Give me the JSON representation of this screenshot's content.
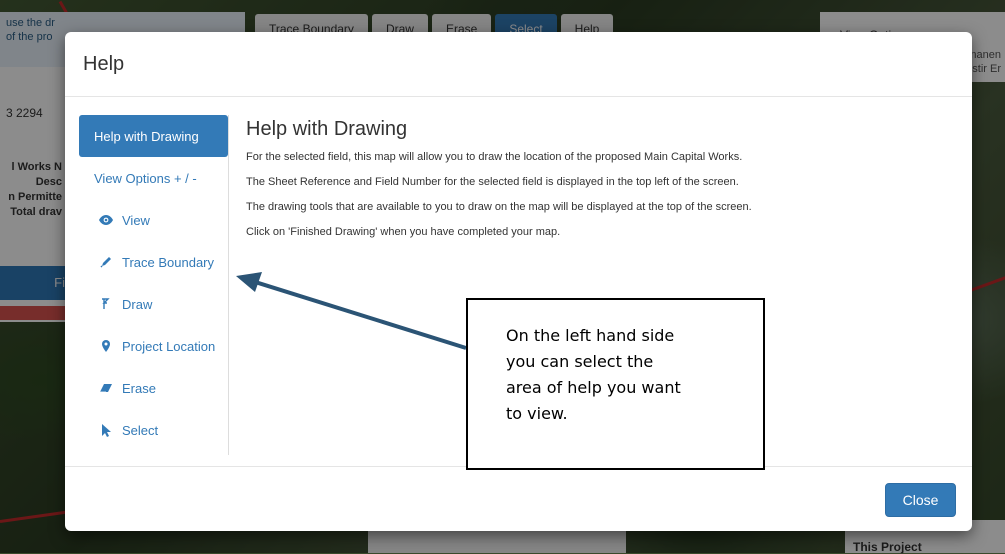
{
  "background": {
    "left_hint_line1": "use the dr",
    "left_hint_line2": "of the pro",
    "left_number": "3 2294",
    "left_lines": [
      "l Works N",
      "Desc",
      "n Permitte",
      "Total drav"
    ],
    "finish_button": "Fi",
    "toolbar": [
      "Trace Boundary",
      "Draw",
      "Erase",
      "Select",
      "Help"
    ],
    "right_title": "View Options",
    "right_text_line1": "nanen",
    "right_text_line2": "stir Er",
    "bottom_card": "This Project"
  },
  "modal": {
    "title": "Help",
    "close_label": "Close",
    "nav": [
      {
        "label": "Help with Drawing",
        "icon": ""
      },
      {
        "label": "View Options + / -",
        "icon": ""
      },
      {
        "label": "View",
        "icon": "eye-icon"
      },
      {
        "label": "Trace Boundary",
        "icon": "pencil-icon"
      },
      {
        "label": "Draw",
        "icon": "draw-icon"
      },
      {
        "label": "Project Location",
        "icon": "map-marker-icon"
      },
      {
        "label": "Erase",
        "icon": "eraser-icon"
      },
      {
        "label": "Select",
        "icon": "cursor-icon"
      }
    ],
    "content": {
      "heading": "Help with Drawing",
      "paragraphs": [
        "For the selected field, this map will allow you to draw the location of the proposed Main Capital Works.",
        "The Sheet Reference and Field Number for the selected field is displayed in the top left of the screen.",
        "The drawing tools that are available to you to draw on the map will be displayed at the top of the screen.",
        "Click on 'Finished Drawing' when you have completed your map."
      ]
    }
  },
  "annotation": {
    "lines": [
      "On the left hand side",
      "you can select the",
      "area of help you want",
      "to view."
    ]
  },
  "colors": {
    "primary": "#337ab7",
    "arrow": "#2b5475",
    "road": "#c42a2a"
  }
}
